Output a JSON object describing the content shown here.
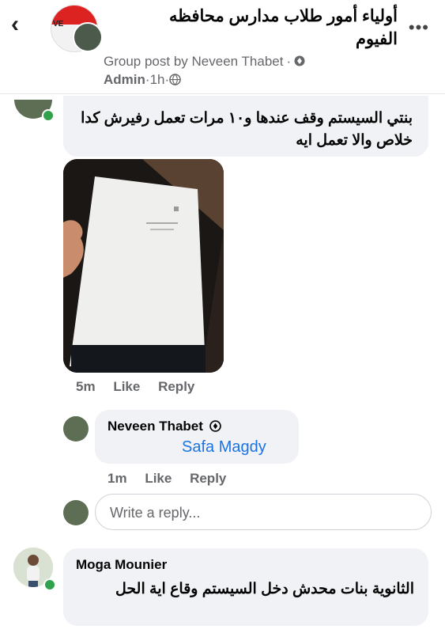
{
  "header": {
    "group_name": "أولياء أمور طلاب مدارس محافظه الفيوم",
    "avatar_text": "VE",
    "post_by_prefix": "Group post by",
    "post_author": "Neveen Thabet",
    "role": "Admin",
    "time": "1h",
    "icons": [
      "back-arrow-icon",
      "more-dots-icon",
      "admin-shield-icon",
      "globe-icon"
    ]
  },
  "comments": [
    {
      "text": "بنتي السيستم وقف عندها و١٠ مرات تعمل رفيرش كدا خلاص والا تعمل ايه",
      "time": "5m",
      "like": "Like",
      "reply": "Reply",
      "has_photo": true
    },
    {
      "author": "Neveen Thabet",
      "mention": "Safa Magdy",
      "time": "1m",
      "like": "Like",
      "reply": "Reply"
    },
    {
      "author": "Moga Mounier",
      "text": "الثانوية بنات محدش دخل السيستم وقاع اية الحل"
    }
  ],
  "reply_box": {
    "placeholder": "Write a reply..."
  },
  "colors": {
    "link_blue": "#1b74e4",
    "online_green": "#31a24c",
    "bubble_bg": "#f0f2f5",
    "meta_gray": "#65676b"
  }
}
